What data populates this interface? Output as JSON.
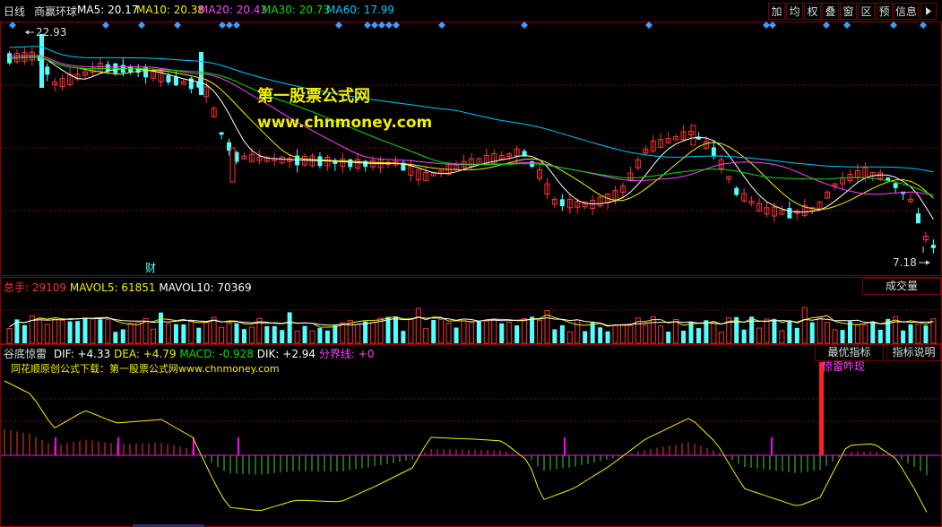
{
  "header": {
    "period": "日线",
    "stock": "商赢环球",
    "ma": [
      {
        "label": "MA5:",
        "value": "20.17",
        "color": "#ffffff"
      },
      {
        "label": "MA10:",
        "value": "20.38",
        "color": "#f0f000"
      },
      {
        "label": "MA20:",
        "value": "20.43",
        "color": "#ff40ff"
      },
      {
        "label": "MA30:",
        "value": "20.73",
        "color": "#00e000"
      },
      {
        "label": "MA60:",
        "value": "17.99",
        "color": "#00c8ff"
      }
    ],
    "tools": [
      "加",
      "均",
      "权",
      "叠",
      "窗",
      "区",
      "预",
      "信息"
    ]
  },
  "price_panel": {
    "high_label": "22.93",
    "low_label": "7.18",
    "event_marker": "财"
  },
  "volume_panel": {
    "total_label": "总手:",
    "total_value": "29109",
    "mavol5_label": "MAVOL5:",
    "mavol5_value": "61851",
    "mavol10_label": "MAVOL10:",
    "mavol10_value": "70369",
    "dropdown": "成交量"
  },
  "indicator_panel": {
    "name": "谷底惊雷",
    "dif_label": "DIF:",
    "dif_value": "+4.33",
    "dea_label": "DEA:",
    "dea_value": "+4.79",
    "macd_label": "MACD:",
    "macd_value": "-0.928",
    "dik_label": "DIK:",
    "dik_value": "+2.94",
    "fenjie_label": "分界线:",
    "fenjie_value": "+0",
    "note": "同花顺原创公式下载：第一股票公式网www.chnmoney.com",
    "signal_label": "惊雷咋现",
    "btn_best": "最优指标",
    "btn_explain": "指标说明"
  },
  "watermark": {
    "line1": "第一股票公式网",
    "line2": "www.chnmoney.com"
  },
  "colors": {
    "up": "#ff3232",
    "down": "#54ffff",
    "grid": "#8b0000",
    "signal": "#ff00ff",
    "dif": "#f0f000"
  },
  "chart_data": [
    {
      "type": "candlestick",
      "ylim": [
        7.18,
        22.93
      ],
      "series": [
        {
          "name": "MA5",
          "value": 20.17
        },
        {
          "name": "MA10",
          "value": 20.38
        },
        {
          "name": "MA20",
          "value": 20.43
        },
        {
          "name": "MA30",
          "value": 20.73
        },
        {
          "name": "MA60",
          "value": 17.99
        }
      ],
      "annotations": [
        "22.93",
        "7.18",
        "财"
      ]
    },
    {
      "type": "bar",
      "series": [
        {
          "name": "总手",
          "value": 29109
        },
        {
          "name": "MAVOL5",
          "value": 61851
        },
        {
          "name": "MAVOL10",
          "value": 70369
        }
      ]
    },
    {
      "type": "line",
      "series": [
        {
          "name": "DIF",
          "value": 4.33
        },
        {
          "name": "DEA",
          "value": 4.79
        },
        {
          "name": "MACD",
          "value": -0.928
        },
        {
          "name": "DIK",
          "value": 2.94
        },
        {
          "name": "分界线",
          "value": 0
        }
      ],
      "annotations": [
        "惊雷咋现"
      ]
    }
  ]
}
